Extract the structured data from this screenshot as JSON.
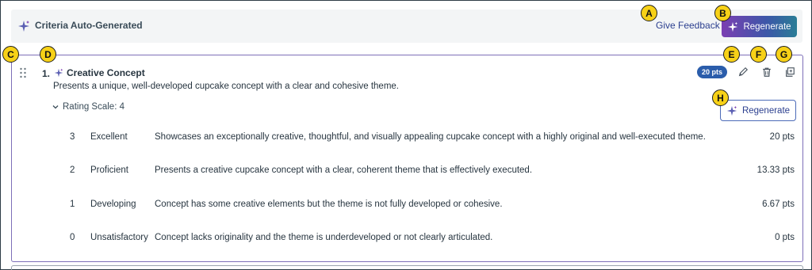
{
  "header": {
    "title": "Criteria Auto-Generated",
    "give_feedback_label": "Give Feedback",
    "regenerate_label": "Regenerate"
  },
  "criterion": {
    "number": "1.",
    "title": "Creative Concept",
    "description": "Presents a unique, well-developed cupcake concept with a clear and cohesive theme.",
    "points_badge": "20 pts",
    "rating_scale_label": "Rating Scale: 4",
    "regenerate_label": "Regenerate",
    "ratings": [
      {
        "score": "3",
        "label": "Excellent",
        "description": "Showcases an exceptionally creative, thoughtful, and visually appealing cupcake concept with a highly original and well-executed theme.",
        "points": "20 pts"
      },
      {
        "score": "2",
        "label": "Proficient",
        "description": "Presents a creative cupcake concept with a clear, coherent theme that is effectively executed.",
        "points": "13.33 pts"
      },
      {
        "score": "1",
        "label": "Developing",
        "description": "Concept has some creative elements but the theme is not fully developed or cohesive.",
        "points": "6.67 pts"
      },
      {
        "score": "0",
        "label": "Unsatisfactory",
        "description": "Concept lacks originality and the theme is underdeveloped or not clearly articulated.",
        "points": "0 pts"
      }
    ]
  },
  "callouts": {
    "a": "A",
    "b": "B",
    "c": "C",
    "d": "D",
    "e": "E",
    "f": "F",
    "g": "G",
    "h": "H"
  },
  "icons": {
    "sparkle": "sparkle-icon",
    "drag": "drag-handle-icon",
    "edit": "pencil-icon",
    "delete": "trash-icon",
    "duplicate": "duplicate-icon",
    "chevron": "chevron-down-icon"
  },
  "colors": {
    "accent": "#2b5dab",
    "link": "#2b3f8f",
    "card_border": "#7d6fb8",
    "callout": "#f7d117",
    "gradient_start": "#7b3fb2",
    "gradient_end": "#2a7d96"
  }
}
